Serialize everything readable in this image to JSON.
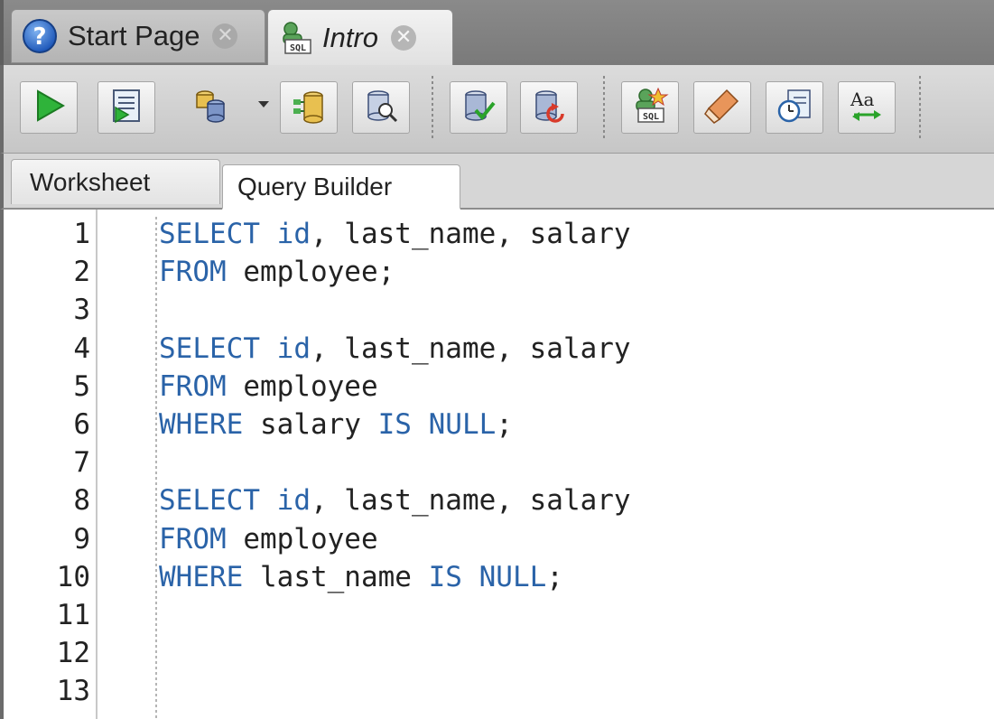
{
  "doc_tabs": [
    {
      "label": "Start Page",
      "icon": "help-icon",
      "active": false
    },
    {
      "label": "Intro",
      "icon": "sql-worksheet-icon",
      "active": true
    }
  ],
  "toolbar": {
    "buttons": [
      {
        "name": "run-statement-button",
        "icon": "play-icon"
      },
      {
        "name": "run-script-button",
        "icon": "script-icon"
      },
      {
        "name": "connection-button",
        "icon": "database-icon"
      },
      {
        "name": "autotrace-button",
        "icon": "autotrace-icon"
      },
      {
        "name": "explain-plan-button",
        "icon": "explain-plan-icon"
      },
      {
        "name": "commit-button",
        "icon": "commit-icon"
      },
      {
        "name": "rollback-button",
        "icon": "rollback-icon"
      },
      {
        "name": "new-sql-button",
        "icon": "sql-new-icon"
      },
      {
        "name": "clear-button",
        "icon": "eraser-icon"
      },
      {
        "name": "sql-history-button",
        "icon": "history-icon"
      },
      {
        "name": "format-case-button",
        "icon": "case-toggle-icon"
      }
    ],
    "case_icon_text": "Aa"
  },
  "sub_tabs": [
    {
      "label": "Worksheet",
      "active": true
    },
    {
      "label": "Query Builder",
      "active": false
    }
  ],
  "editor": {
    "line_numbers": [
      "1",
      "2",
      "3",
      "4",
      "5",
      "6",
      "7",
      "8",
      "9",
      "10",
      "11",
      "12",
      "13"
    ],
    "lines": [
      [
        {
          "t": "SELECT",
          "k": true
        },
        {
          "t": " ",
          "k": false
        },
        {
          "t": "id",
          "k": true
        },
        {
          "t": ", last_name, salary",
          "k": false
        }
      ],
      [
        {
          "t": "FROM",
          "k": true
        },
        {
          "t": " employee;",
          "k": false
        }
      ],
      [],
      [
        {
          "t": "SELECT",
          "k": true
        },
        {
          "t": " ",
          "k": false
        },
        {
          "t": "id",
          "k": true
        },
        {
          "t": ", last_name, salary",
          "k": false
        }
      ],
      [
        {
          "t": "FROM",
          "k": true
        },
        {
          "t": " employee",
          "k": false
        }
      ],
      [
        {
          "t": "WHERE",
          "k": true
        },
        {
          "t": " salary ",
          "k": false
        },
        {
          "t": "IS",
          "k": true
        },
        {
          "t": " ",
          "k": false
        },
        {
          "t": "NULL",
          "k": true
        },
        {
          "t": ";",
          "k": false
        }
      ],
      [],
      [
        {
          "t": "SELECT",
          "k": true
        },
        {
          "t": " ",
          "k": false
        },
        {
          "t": "id",
          "k": true
        },
        {
          "t": ", last_name, salary",
          "k": false
        }
      ],
      [
        {
          "t": "FROM",
          "k": true
        },
        {
          "t": " employee",
          "k": false
        }
      ],
      [
        {
          "t": "WHERE",
          "k": true
        },
        {
          "t": " last_name ",
          "k": false
        },
        {
          "t": "IS",
          "k": true
        },
        {
          "t": " ",
          "k": false
        },
        {
          "t": "NULL",
          "k": true
        },
        {
          "t": ";",
          "k": false
        }
      ],
      [],
      [],
      []
    ]
  },
  "colors": {
    "keyword": "#2a63a8",
    "text": "#222222"
  }
}
